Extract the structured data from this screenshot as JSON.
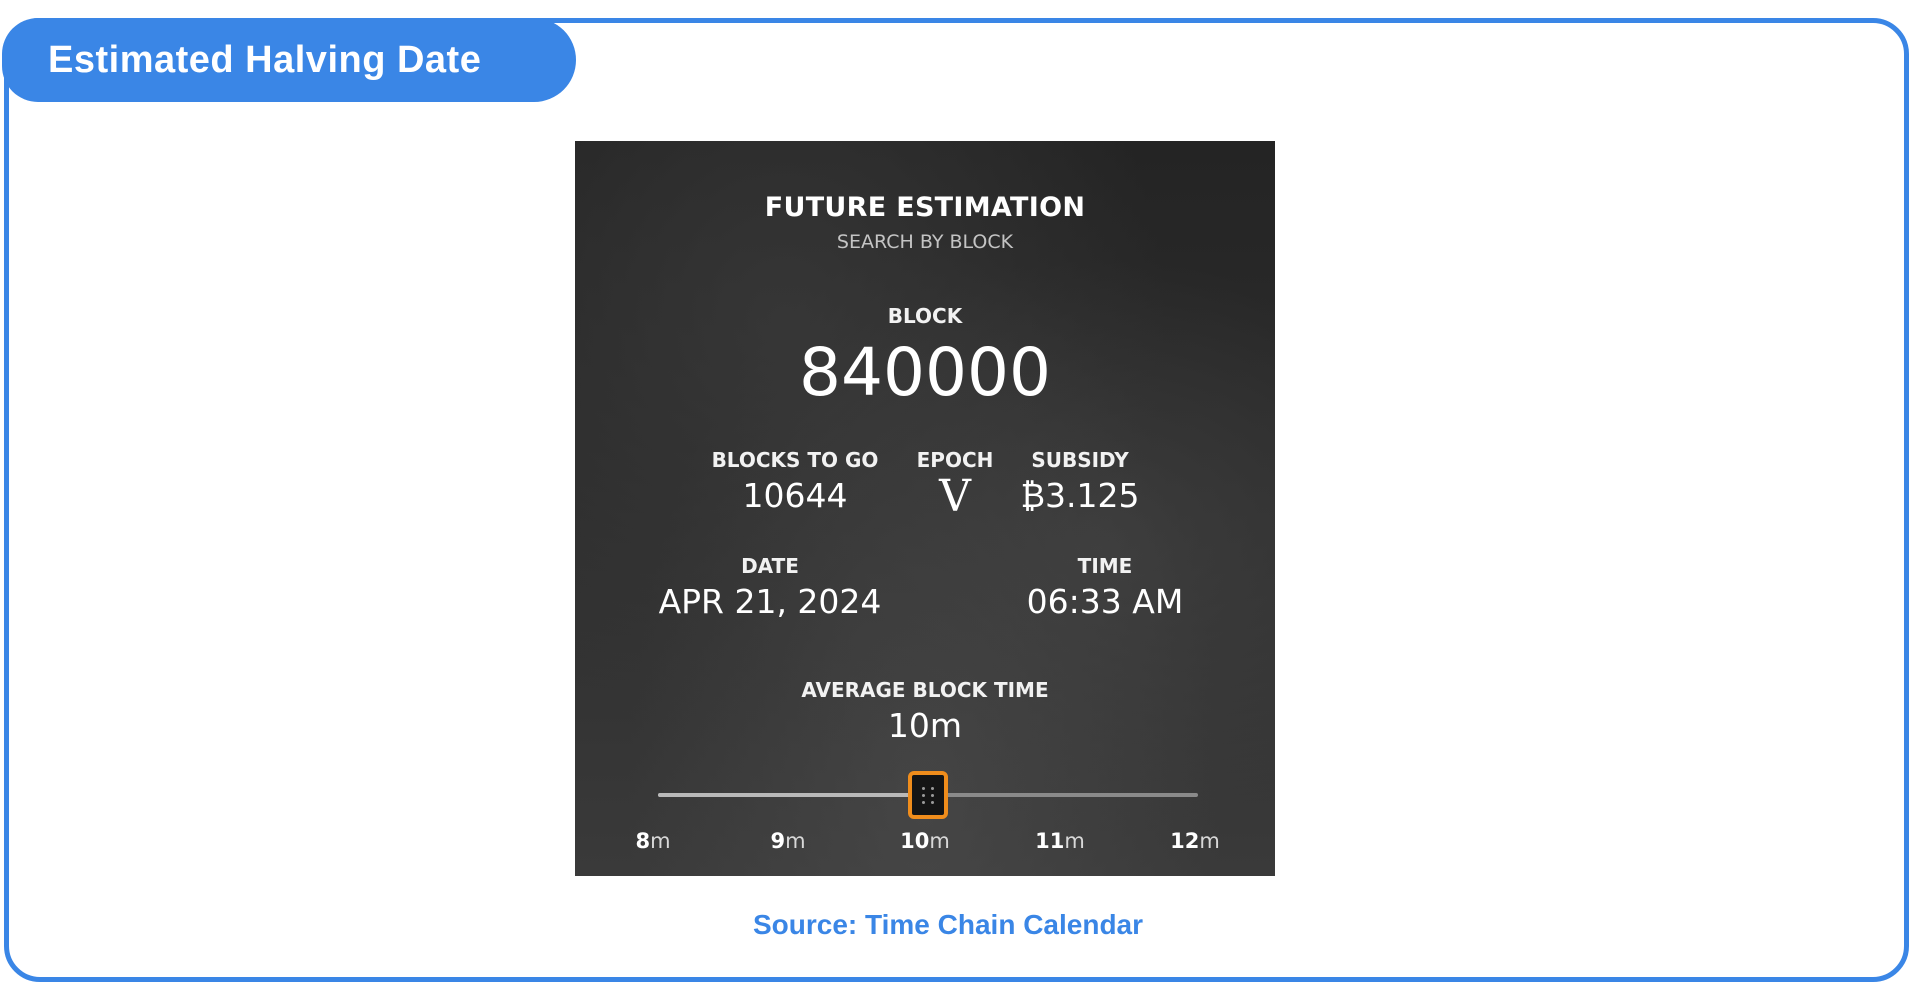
{
  "header": {
    "tag_label": "Estimated Halving Date"
  },
  "widget": {
    "title": "FUTURE ESTIMATION",
    "subtitle": "SEARCH BY BLOCK",
    "block": {
      "label": "BLOCK",
      "value": "840000"
    },
    "blocks_to_go": {
      "label": "BLOCKS TO GO",
      "value": "10644"
    },
    "epoch": {
      "label": "EPOCH",
      "value": "V"
    },
    "subsidy": {
      "label": "SUBSIDY",
      "value": "₿3.125"
    },
    "date": {
      "label": "DATE",
      "value": "APR 21, 2024"
    },
    "time": {
      "label": "TIME",
      "value": "06:33 AM"
    },
    "average_block_time": {
      "label": "AVERAGE BLOCK TIME",
      "value": "10m",
      "slider_min": 8,
      "slider_max": 12,
      "slider_value": 10,
      "accent_color": "#f08d1c",
      "ticks": [
        {
          "num": "8",
          "unit": "m"
        },
        {
          "num": "9",
          "unit": "m"
        },
        {
          "num": "10",
          "unit": "m"
        },
        {
          "num": "11",
          "unit": "m"
        },
        {
          "num": "12",
          "unit": "m"
        }
      ]
    }
  },
  "footer": {
    "source": "Source: Time Chain Calendar"
  },
  "colors": {
    "brand": "#3a86e6",
    "widget_bg": "#2c2c2c"
  }
}
